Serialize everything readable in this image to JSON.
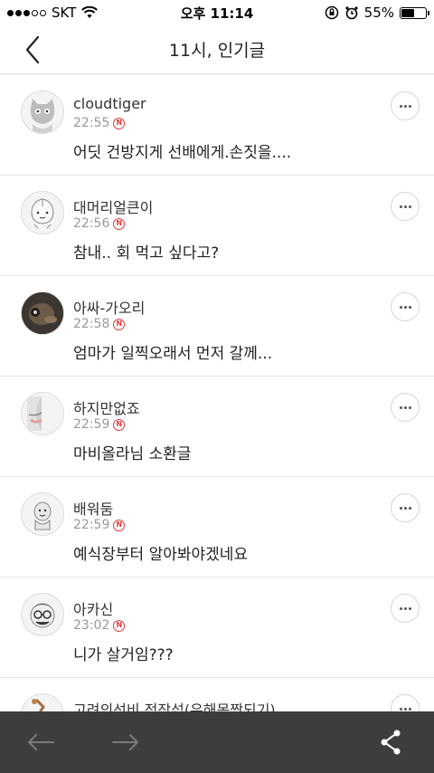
{
  "status_bar": {
    "carrier": "SKT",
    "time": "오후 11:14",
    "battery": "55%",
    "battery_level": 0.55
  },
  "header": {
    "title": "11시, 인기글",
    "back_icon": "chevron-left-icon"
  },
  "comments": [
    {
      "author": "cloudtiger",
      "time": "22:55",
      "text": "어딧 건방지게 선배에게.손짓을....",
      "avatar": "cat-avatar"
    },
    {
      "author": "대머리얼큰이",
      "time": "22:56",
      "text": "참내.. 회 먹고 싶다고?",
      "avatar": "apeach-avatar"
    },
    {
      "author": "아싸-가오리",
      "time": "22:58",
      "text": "엄마가 일찍오래서 먼저 갈께...",
      "avatar": "photo-avatar"
    },
    {
      "author": "하지만없죠",
      "time": "22:59",
      "text": "마비올라님 소환글",
      "avatar": "face-avatar"
    },
    {
      "author": "배워둠",
      "time": "22:59",
      "text": "예식장부터 알아봐야겠네요",
      "avatar": "character-avatar"
    },
    {
      "author": "아카신",
      "time": "23:02",
      "text": "니가 살거임???",
      "avatar": "glasses-avatar"
    },
    {
      "author": "고려의선비 정장섭(우해목짱되기)",
      "time": "",
      "text": "",
      "avatar": "figure-avatar"
    }
  ],
  "new_badge": "N",
  "bottom_bar": {
    "icons": [
      "arrow-left-icon",
      "arrow-right-icon",
      "share-icon"
    ]
  },
  "colors": {
    "accent_new": "#e23a3a",
    "bottom_bar": "#3d3d3f"
  }
}
